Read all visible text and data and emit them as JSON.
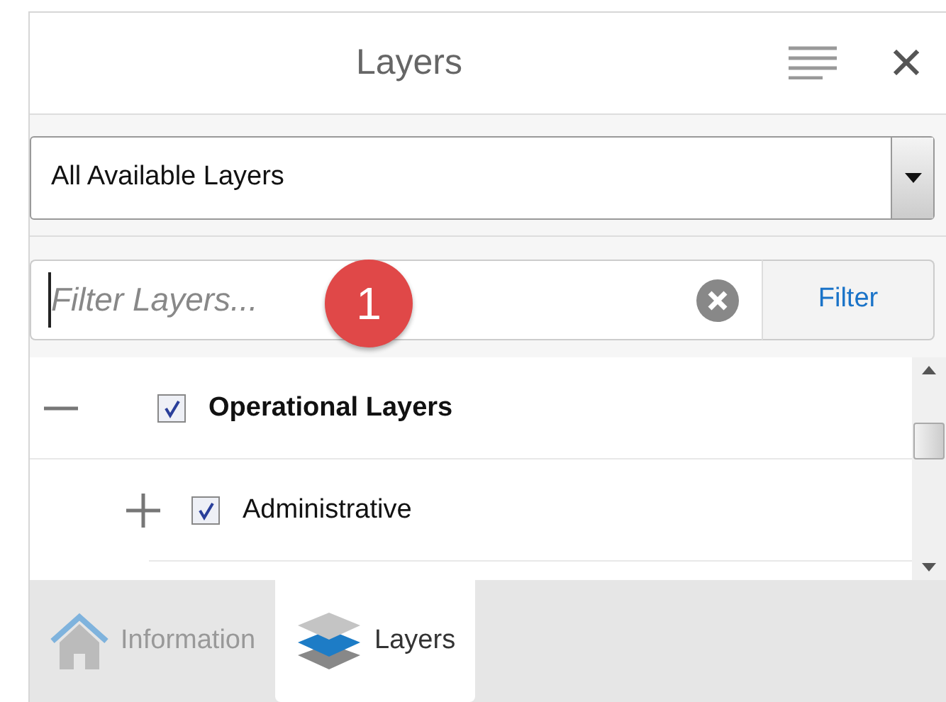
{
  "panel": {
    "title": "Layers"
  },
  "layer_scope": {
    "value": "All Available Layers"
  },
  "filter": {
    "placeholder": "Filter Layers...",
    "button": "Filter",
    "callout": "1"
  },
  "tree": [
    {
      "label": "Operational Layers",
      "checked": true,
      "expanded": true,
      "children": [
        {
          "label": "Administrative",
          "checked": true,
          "expanded": false
        }
      ]
    }
  ],
  "tabs": [
    {
      "label": "Information",
      "selected": false,
      "kind": "home"
    },
    {
      "label": "Layers",
      "selected": true,
      "kind": "layers"
    }
  ]
}
